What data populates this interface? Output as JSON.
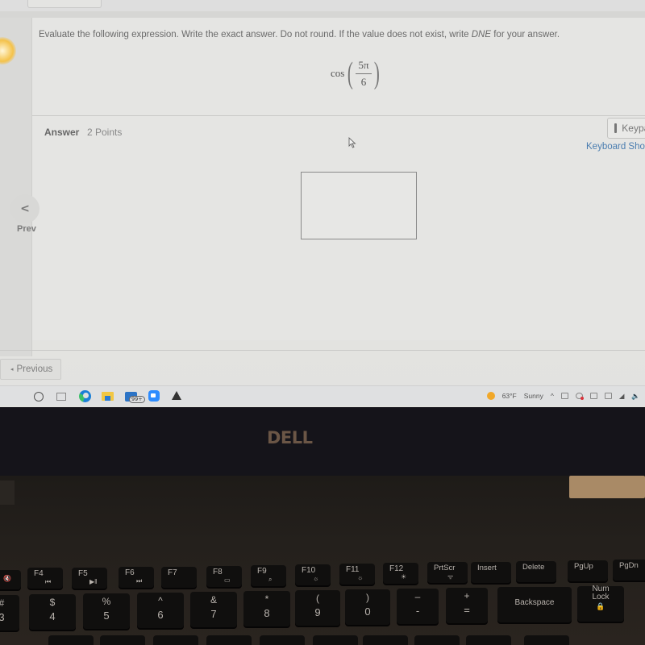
{
  "question": {
    "instruction_part1": "Evaluate the following expression. Write the exact answer. Do not round. If the value does not exist, write ",
    "instruction_em": "DNE",
    "instruction_part2": " for your answer.",
    "expression": {
      "function": "cos",
      "numerator": "5π",
      "denominator": "6"
    }
  },
  "answer": {
    "label": "Answer",
    "points": "2 Points",
    "value": ""
  },
  "tools": {
    "keypad_label": "Keypad",
    "shortcuts_link": "Keyboard Shortcuts"
  },
  "nav": {
    "prev_arrow": "<",
    "prev_label": "Prev",
    "previous_button": "Previous",
    "previous_arrow": "◂"
  },
  "taskbar": {
    "mail_badge": "99+",
    "weather_temp": "63°F",
    "weather_condition": "Sunny",
    "tray_chevron": "^"
  },
  "laptop": {
    "brand": "DELL"
  },
  "keyboard": {
    "function_row": [
      {
        "label": "F4",
        "icon": "⏮"
      },
      {
        "label": "F5",
        "icon": "▶‖"
      },
      {
        "label": "F6",
        "icon": "⏭"
      },
      {
        "label": "F7",
        "icon": ""
      },
      {
        "label": "F8",
        "icon": "▭"
      },
      {
        "label": "F9",
        "icon": "⌕"
      },
      {
        "label": "F10",
        "icon": "☼"
      },
      {
        "label": "F11",
        "icon": "☼"
      },
      {
        "label": "F12",
        "icon": "☀"
      },
      {
        "label": "PrtScr",
        "icon": "ᯤ"
      },
      {
        "label": "Insert",
        "icon": ""
      },
      {
        "label": "Delete",
        "icon": ""
      },
      {
        "label": "PgUp",
        "icon": ""
      },
      {
        "label": "PgDn",
        "icon": ""
      }
    ],
    "number_row": [
      {
        "top": "#",
        "bottom": "3"
      },
      {
        "top": "$",
        "bottom": "4"
      },
      {
        "top": "%",
        "bottom": "5"
      },
      {
        "top": "^",
        "bottom": "6"
      },
      {
        "top": "&",
        "bottom": "7"
      },
      {
        "top": "*",
        "bottom": "8"
      },
      {
        "top": "(",
        "bottom": "9"
      },
      {
        "top": ")",
        "bottom": "0"
      },
      {
        "top": "–",
        "bottom": "-"
      },
      {
        "top": "+",
        "bottom": "="
      },
      {
        "top": "Backspace",
        "bottom": ""
      },
      {
        "top": "Num Lock",
        "bottom": "🔒"
      }
    ],
    "mute_key_icon": "🔇"
  }
}
